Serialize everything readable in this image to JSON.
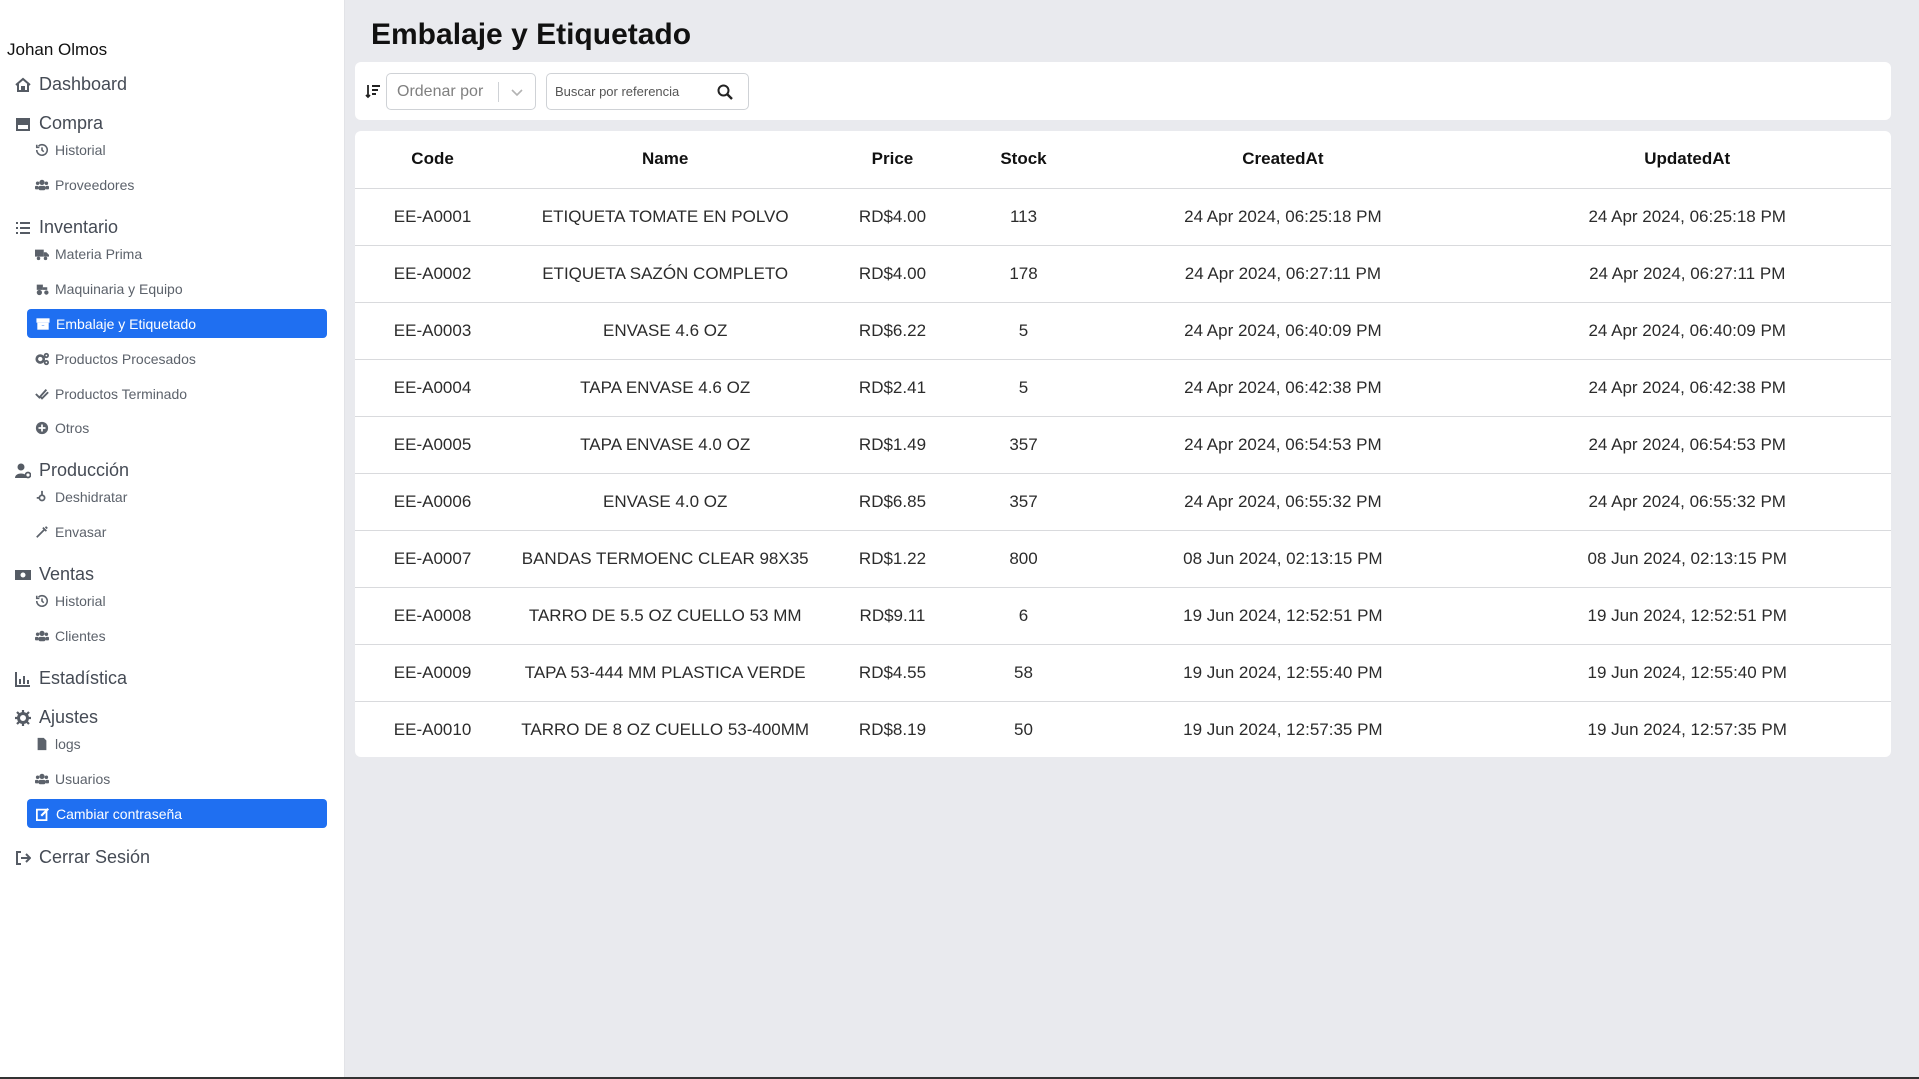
{
  "user": {
    "name": "Johan Olmos"
  },
  "sidebar": {
    "dashboard": "Dashboard",
    "compra": {
      "label": "Compra",
      "items": [
        "Historial",
        "Proveedores"
      ]
    },
    "inventario": {
      "label": "Inventario",
      "items": [
        "Materia Prima",
        "Maquinaria y Equipo",
        "Embalaje y Etiquetado",
        "Productos Procesados",
        "Productos Terminado",
        "Otros"
      ]
    },
    "produccion": {
      "label": "Producción",
      "items": [
        "Deshidratar",
        "Envasar"
      ]
    },
    "ventas": {
      "label": "Ventas",
      "items": [
        "Historial",
        "Clientes"
      ]
    },
    "estadistica": "Estadística",
    "ajustes": {
      "label": "Ajustes",
      "items": [
        "logs",
        "Usuarios",
        "Cambiar contraseña"
      ]
    },
    "logout": "Cerrar Sesión",
    "active_color": "#1f6ff1"
  },
  "page": {
    "title": "Embalaje y Etiquetado"
  },
  "toolbar": {
    "sort_placeholder": "Ordenar por",
    "search_placeholder": "Buscar por referencia"
  },
  "table": {
    "columns": [
      "Code",
      "Name",
      "Price",
      "Stock",
      "CreatedAt",
      "UpdatedAt"
    ],
    "rows": [
      [
        "EE-A0001",
        "ETIQUETA TOMATE EN POLVO",
        "RD$4.00",
        "113",
        "24 Apr 2024, 06:25:18 PM",
        "24 Apr 2024, 06:25:18 PM"
      ],
      [
        "EE-A0002",
        "ETIQUETA SAZÓN COMPLETO",
        "RD$4.00",
        "178",
        "24 Apr 2024, 06:27:11 PM",
        "24 Apr 2024, 06:27:11 PM"
      ],
      [
        "EE-A0003",
        "ENVASE 4.6 OZ",
        "RD$6.22",
        "5",
        "24 Apr 2024, 06:40:09 PM",
        "24 Apr 2024, 06:40:09 PM"
      ],
      [
        "EE-A0004",
        "TAPA ENVASE 4.6 OZ",
        "RD$2.41",
        "5",
        "24 Apr 2024, 06:42:38 PM",
        "24 Apr 2024, 06:42:38 PM"
      ],
      [
        "EE-A0005",
        "TAPA ENVASE 4.0 OZ",
        "RD$1.49",
        "357",
        "24 Apr 2024, 06:54:53 PM",
        "24 Apr 2024, 06:54:53 PM"
      ],
      [
        "EE-A0006",
        "ENVASE 4.0 OZ",
        "RD$6.85",
        "357",
        "24 Apr 2024, 06:55:32 PM",
        "24 Apr 2024, 06:55:32 PM"
      ],
      [
        "EE-A0007",
        "BANDAS TERMOENC CLEAR 98X35",
        "RD$1.22",
        "800",
        "08 Jun 2024, 02:13:15 PM",
        "08 Jun 2024, 02:13:15 PM"
      ],
      [
        "EE-A0008",
        "TARRO DE 5.5 OZ CUELLO 53 MM",
        "RD$9.11",
        "6",
        "19 Jun 2024, 12:52:51 PM",
        "19 Jun 2024, 12:52:51 PM"
      ],
      [
        "EE-A0009",
        "TAPA 53-444 MM PLASTICA VERDE",
        "RD$4.55",
        "58",
        "19 Jun 2024, 12:55:40 PM",
        "19 Jun 2024, 12:55:40 PM"
      ],
      [
        "EE-A0010",
        "TARRO DE 8 OZ CUELLO 53-400MM",
        "RD$8.19",
        "50",
        "19 Jun 2024, 12:57:35 PM",
        "19 Jun 2024, 12:57:35 PM"
      ]
    ]
  }
}
